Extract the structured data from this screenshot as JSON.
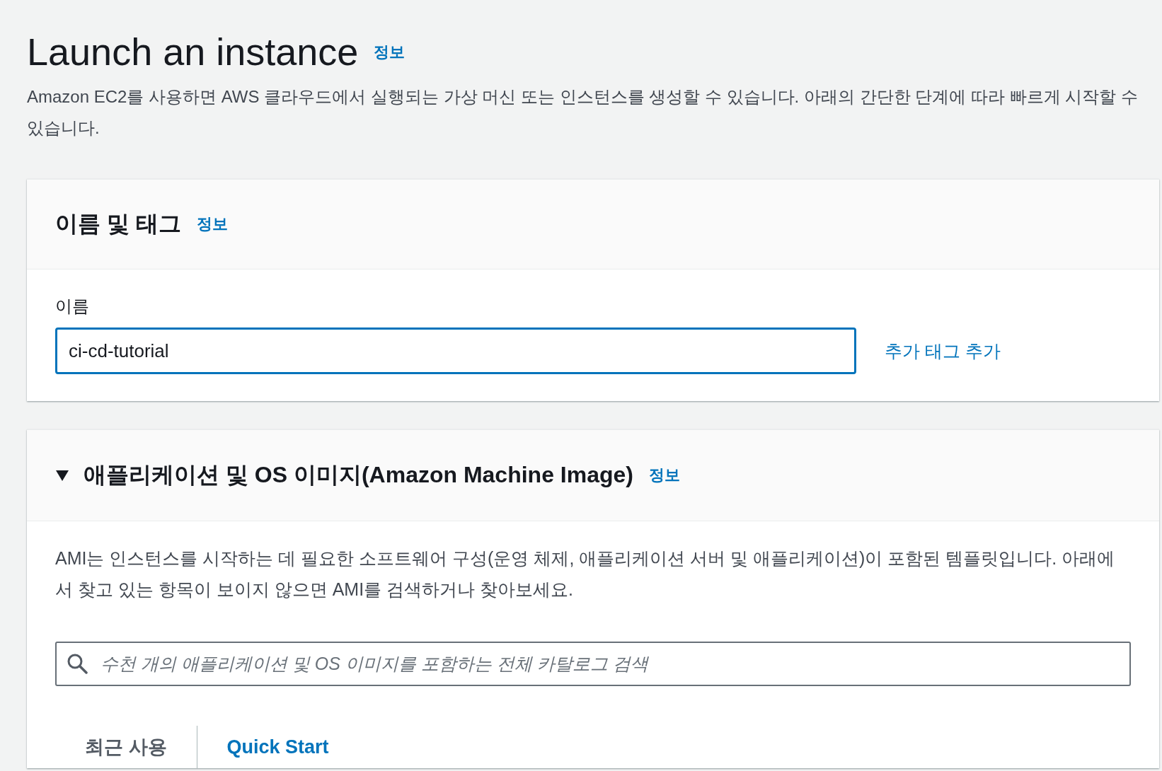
{
  "page": {
    "title": "Launch an instance",
    "info_link": "정보",
    "description": "Amazon EC2를 사용하면 AWS 클라우드에서 실행되는 가상 머신 또는 인스턴스를 생성할 수 있습니다. 아래의 간단한 단계에 따라 빠르게 시작할 수 있습니다."
  },
  "name_section": {
    "title": "이름 및 태그",
    "info_link": "정보",
    "name_field": {
      "label": "이름",
      "value": "ci-cd-tutorial",
      "focused": true
    },
    "add_tags_link": "추가 태그 추가"
  },
  "ami_section": {
    "title": "애플리케이션 및 OS 이미지(Amazon Machine Image)",
    "info_link": "정보",
    "expanded": true,
    "description": "AMI는 인스턴스를 시작하는 데 필요한 소프트웨어 구성(운영 체제, 애플리케이션 서버 및 애플리케이션)이 포함된 템플릿입니다. 아래에서 찾고 있는 항목이 보이지 않으면 AMI를 검색하거나 찾아보세요.",
    "search": {
      "placeholder": "수천 개의 애플리케이션 및 OS 이미지를 포함하는 전체 카탈로그 검색"
    },
    "tabs": [
      {
        "label": "최근 사용",
        "selected": false
      },
      {
        "label": "Quick Start",
        "selected": true
      }
    ]
  }
}
